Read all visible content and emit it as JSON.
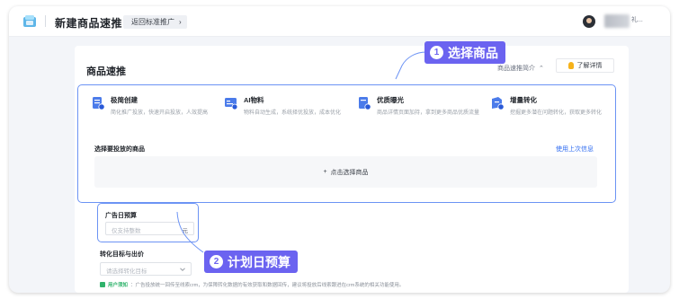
{
  "app": {
    "title": "新建商品速推"
  },
  "header": {
    "back_label": "返回标准推广",
    "back_chevron": "›",
    "user_name": "礼..."
  },
  "card": {
    "title": "商品速推",
    "intro_label": "商品速推简介",
    "intro_chevron": "⌃",
    "detail_label": "了解详情"
  },
  "types": [
    {
      "name": "极简创建",
      "desc": "简化推广投放，快速开启投放，人效提高"
    },
    {
      "name": "AI物料",
      "desc": "物料自动生成，系统择优投放，成本优化"
    },
    {
      "name": "优质曝光",
      "desc": "商品详情页面加持，拿到更多商品优质流量"
    },
    {
      "name": "增量转化",
      "desc": "挖掘更多潜在问题转化，获取更多转化"
    }
  ],
  "product": {
    "label": "选择要投放的商品",
    "last_link": "使用上次信息",
    "add_icon": "+",
    "add_label": "点击选择商品"
  },
  "budget": {
    "label": "广告日预算",
    "placeholder": "仅支持整数",
    "unit": "元"
  },
  "conversion": {
    "label": "转化目标与出价",
    "placeholder": "请选择转化目标"
  },
  "notice": {
    "tag": "用户须知",
    "text": "：广告投放统一回传至线索crm，为保障转化数据的有效获取和数据回传，建议将投放后线索跟进在crm系统的相关功能使用。"
  },
  "callouts": {
    "select_product": {
      "num": "1",
      "label": "选择商品"
    },
    "daily_budget": {
      "num": "2",
      "label": "计划日预算"
    }
  },
  "colors": {
    "accent": "#2e6bf0",
    "callout": "#6b63f0",
    "highlight_border": "#6c93f4",
    "tip": "#2fb36b"
  }
}
